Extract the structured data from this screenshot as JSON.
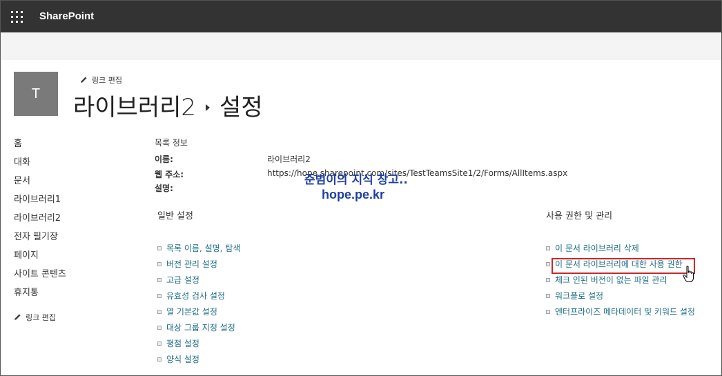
{
  "app": {
    "brand": "SharePoint"
  },
  "site": {
    "logo_letter": "T",
    "edit_link": "링크 편집"
  },
  "title": {
    "library": "라이브러리2",
    "page": "설정"
  },
  "nav": {
    "items": [
      "홈",
      "대화",
      "문서",
      "라이브러리1",
      "라이브러리2",
      "전자 필기장",
      "페이지",
      "사이트 콘텐츠",
      "휴지통"
    ],
    "edit_link": "링크 편집"
  },
  "list_info": {
    "heading": "목록 정보",
    "name_label": "이름:",
    "name_value": "라이브러리2",
    "url_label": "웹 주소:",
    "url_value": "https://hope.sharepoint.com/sites/TestTeamsSite1/2/Forms/AllItems.aspx",
    "desc_label": "설명:"
  },
  "watermark": {
    "line1": "준범이의 지식 창고..",
    "line2": "hope.pe.kr"
  },
  "general": {
    "heading": "일반 설정",
    "links": [
      "목록 이름, 설명, 탐색",
      "버전 관리 설정",
      "고급 설정",
      "유효성 검사 설정",
      "열 기본값 설정",
      "대상 그룹 지정 설정",
      "평점 설정",
      "양식 설정"
    ]
  },
  "permissions": {
    "heading": "사용 권한 및 관리",
    "links": [
      "이 문서 라이브러리 삭제",
      "이 문서 라이브러리에 대한 사용 권한",
      "체크 인된 버전이 없는 파일 관리",
      "워크플로 설정",
      "엔터프라이즈 메타데이터 및 키워드 설정"
    ]
  },
  "colors": {
    "topbar": "#333333",
    "link": "#1e6c88",
    "highlight": "#c62828",
    "watermark": "#1f3fa0"
  }
}
